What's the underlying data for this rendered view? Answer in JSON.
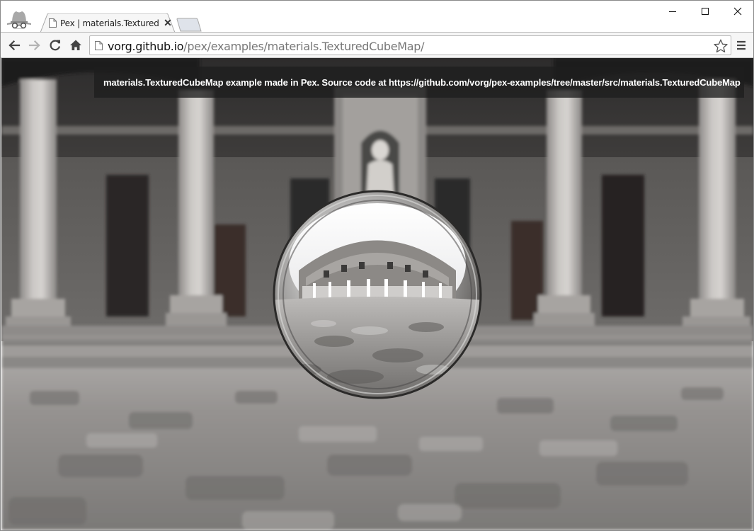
{
  "browser": {
    "tab": {
      "title": "Pex | materials.TexturedCu",
      "close_glyph": "✕"
    },
    "icons": {
      "incognito": "incognito-icon",
      "favicon": "page-icon",
      "back": "back-arrow-icon",
      "forward": "forward-arrow-icon",
      "reload": "reload-icon",
      "home": "home-icon",
      "star": "star-icon",
      "menu": "hamburger-menu-icon",
      "minimize": "minimize-icon",
      "maximize": "maximize-icon",
      "close": "close-icon"
    },
    "address": {
      "host": "vorg.github.io",
      "path": "/pex/examples/materials.TexturedCubeMap/"
    }
  },
  "page": {
    "info": {
      "prefix": "materials.TexturedCubeMap example made in Pex. Source code at ",
      "link": "https://github.com/vorg/pex-examples/tree/master/src/materials.TexturedCubeMap"
    }
  },
  "colors": {
    "sky": "#2a2a2a",
    "stone": "#b8b5b2",
    "floor": "#8d8b89",
    "banner": "#1e1e1e"
  }
}
